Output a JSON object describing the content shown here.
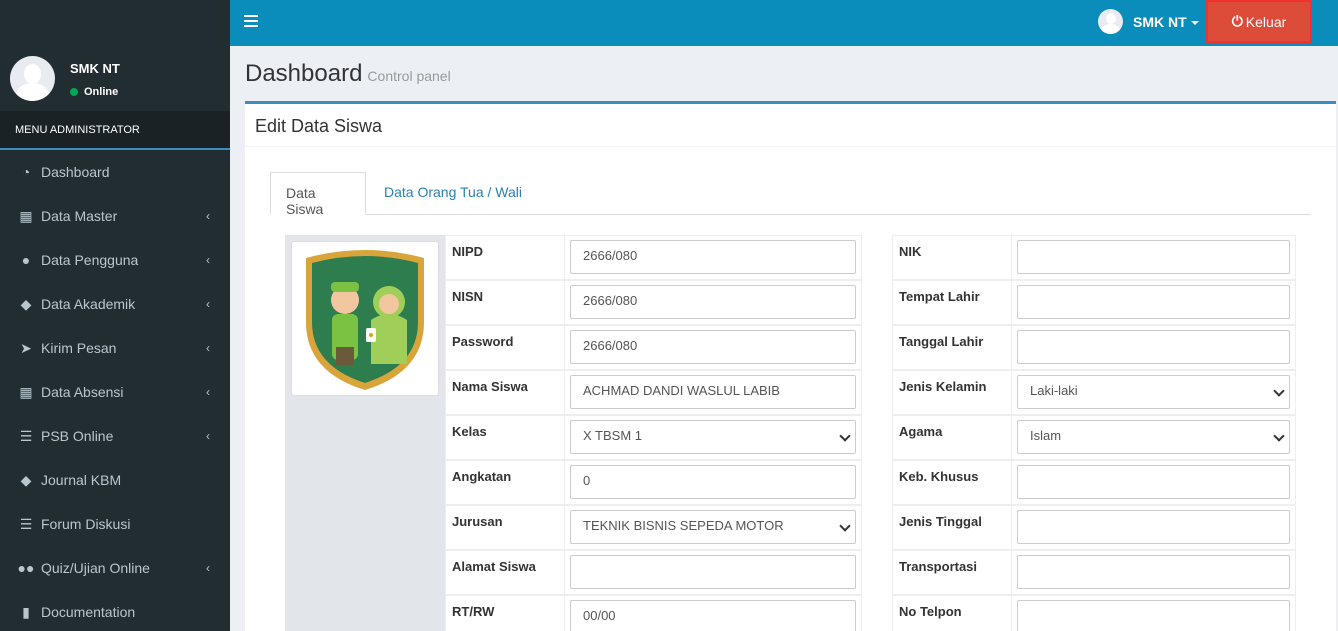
{
  "sidebar": {
    "user_name": "SMK NT",
    "status": "Online",
    "menu_header": "MENU ADMINISTRATOR",
    "items": [
      {
        "label": "Dashboard",
        "icon": "dashboard-icon",
        "expandable": false
      },
      {
        "label": "Data Master",
        "icon": "grid-icon",
        "expandable": true
      },
      {
        "label": "Data Pengguna",
        "icon": "user-icon",
        "expandable": true
      },
      {
        "label": "Data Akademik",
        "icon": "tag-icon",
        "expandable": true
      },
      {
        "label": "Kirim Pesan",
        "icon": "paper-plane-icon",
        "expandable": true
      },
      {
        "label": "Data Absensi",
        "icon": "grid-icon",
        "expandable": true
      },
      {
        "label": "PSB Online",
        "icon": "list-icon",
        "expandable": true
      },
      {
        "label": "Journal KBM",
        "icon": "tags-icon",
        "expandable": false
      },
      {
        "label": "Forum Diskusi",
        "icon": "list-icon",
        "expandable": false
      },
      {
        "label": "Quiz/Ujian Online",
        "icon": "users-icon",
        "expandable": true
      },
      {
        "label": "Documentation",
        "icon": "book-icon",
        "expandable": false
      }
    ]
  },
  "topbar": {
    "user_name": "SMK NT",
    "logout_label": "Keluar"
  },
  "content": {
    "title": "Dashboard",
    "subtitle": "Control panel",
    "box_title": "Edit Data Siswa",
    "tabs": [
      {
        "label": "Data Siswa",
        "active": true
      },
      {
        "label": "Data Orang Tua / Wali",
        "active": false
      }
    ]
  },
  "form_left": [
    {
      "label": "NIPD",
      "value": "2666/080",
      "type": "input"
    },
    {
      "label": "NISN",
      "value": "2666/080",
      "type": "input"
    },
    {
      "label": "Password",
      "value": "2666/080",
      "type": "input"
    },
    {
      "label": "Nama Siswa",
      "value": "ACHMAD DANDI WASLUL LABIB",
      "type": "input"
    },
    {
      "label": "Kelas",
      "value": "X TBSM 1",
      "type": "select"
    },
    {
      "label": "Angkatan",
      "value": "0",
      "type": "input"
    },
    {
      "label": "Jurusan",
      "value": "TEKNIK BISNIS SEPEDA MOTOR",
      "type": "select"
    },
    {
      "label": "Alamat Siswa",
      "value": "",
      "type": "input"
    },
    {
      "label": "RT/RW",
      "value": "00/00",
      "type": "input"
    }
  ],
  "form_right": [
    {
      "label": "NIK",
      "value": "",
      "type": "input"
    },
    {
      "label": "Tempat Lahir",
      "value": "",
      "type": "input"
    },
    {
      "label": "Tanggal Lahir",
      "value": "",
      "type": "input"
    },
    {
      "label": "Jenis Kelamin",
      "value": "Laki-laki",
      "type": "select"
    },
    {
      "label": "Agama",
      "value": "Islam",
      "type": "select"
    },
    {
      "label": "Keb. Khusus",
      "value": "",
      "type": "input"
    },
    {
      "label": "Jenis Tinggal",
      "value": "",
      "type": "input"
    },
    {
      "label": "Transportasi",
      "value": "",
      "type": "input"
    },
    {
      "label": "No Telpon",
      "value": "",
      "type": "input"
    }
  ]
}
